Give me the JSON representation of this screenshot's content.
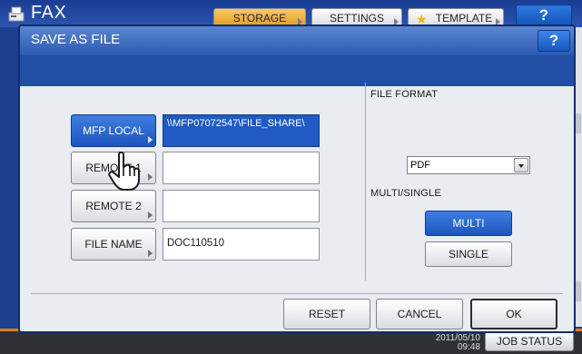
{
  "background_app": {
    "title": "FAX",
    "app_icon": "fax-machine-icon",
    "tabs": [
      {
        "label": "STORAGE",
        "active": true
      },
      {
        "label": "SETTINGS",
        "active": false
      },
      {
        "label": "TEMPLATE",
        "active": false,
        "icon": "star-icon"
      }
    ],
    "help_label": "?",
    "clock_date": "2011/05/10",
    "clock_time": "09:48",
    "job_status_label": "JOB STATUS"
  },
  "dialog": {
    "title": "SAVE AS FILE",
    "help_label": "?",
    "destinations": [
      {
        "label": "MFP LOCAL",
        "selected": true,
        "path": "\\\\MFP07072547\\FILE_SHARE\\"
      },
      {
        "label": "REMOTE 1",
        "selected": false,
        "path": ""
      },
      {
        "label": "REMOTE 2",
        "selected": false,
        "path": ""
      }
    ],
    "file_name_label": "FILE NAME",
    "file_name_value": "DOC110510",
    "file_format_label": "FILE FORMAT",
    "file_format_value": "PDF",
    "multi_single_label": "MULTI/SINGLE",
    "multi_label": "MULTI",
    "single_label": "SINGLE",
    "mode_selected": "MULTI",
    "reset_label": "RESET",
    "cancel_label": "CANCEL",
    "ok_label": "OK"
  },
  "colors": {
    "accent_blue": "#1f5bc2",
    "title_bar": "#2c5ab2",
    "storage_tab": "#e39b1f",
    "bottom_bar": "#2e3136"
  },
  "overlay": {
    "pointer": "hand-pointer-icon"
  }
}
